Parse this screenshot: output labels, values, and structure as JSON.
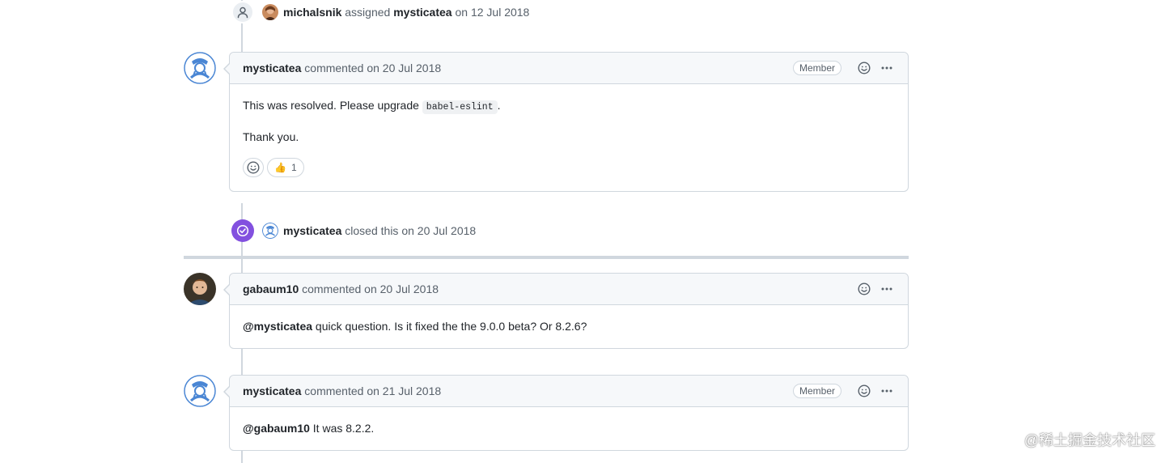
{
  "events": {
    "assigned": {
      "actor": "michalsnik",
      "verb": "assigned",
      "target": "mysticatea",
      "date": "on 12 Jul 2018"
    },
    "closed": {
      "actor": "mysticatea",
      "verb": "closed this",
      "date": "on 20 Jul 2018"
    }
  },
  "comments": [
    {
      "author": "mysticatea",
      "meta": "commented on 20 Jul 2018",
      "role": "Member",
      "body_before_code": "This was resolved. Please upgrade ",
      "code": "babel-eslint",
      "body_after_code": ".",
      "body_line2": "Thank you.",
      "reaction_emoji": "👍",
      "reaction_count": "1"
    },
    {
      "author": "gabaum10",
      "meta": "commented on 20 Jul 2018",
      "mention": "@mysticatea",
      "body": " quick question. Is it fixed the the 9.0.0 beta? Or 8.2.6?"
    },
    {
      "author": "mysticatea",
      "meta": "commented on 21 Jul 2018",
      "role": "Member",
      "mention": "@gabaum10",
      "body": " It was 8.2.2."
    }
  ],
  "icons": {
    "person": "person-icon",
    "check": "check-circle-icon",
    "smiley": "smiley-icon",
    "kebab": "kebab-horizontal-icon"
  },
  "colors": {
    "closed_badge": "#8250df",
    "border": "#d0d7de",
    "header_bg": "#f6f8fa"
  },
  "watermark": "@稀土掘金技术社区"
}
